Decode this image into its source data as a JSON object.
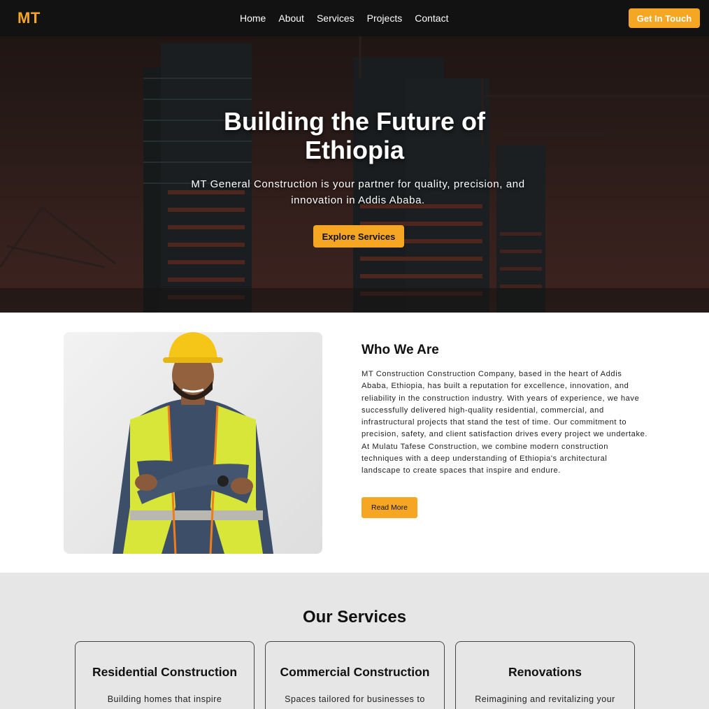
{
  "brand": {
    "logo": "MT",
    "accent_color": "#f5a623"
  },
  "nav": {
    "links": [
      "Home",
      "About",
      "Services",
      "Projects",
      "Contact"
    ],
    "cta_label": "Get In Touch"
  },
  "hero": {
    "title_line1": "Building the Future of",
    "title_line2": "Ethiopia",
    "subtitle": "MT General Construction is your partner for quality, precision, and innovation in Addis Ababa.",
    "button_label": "Explore Services"
  },
  "about": {
    "title": "Who We Are",
    "body": "MT Construction Construction Company, based in the heart of Addis Ababa, Ethiopia, has built a reputation for excellence, innovation, and reliability in the construction industry. With years of experience, we have successfully delivered high-quality residential, commercial, and infrastructural projects that stand the test of time. Our commitment to precision, safety, and client satisfaction drives every project we undertake. At Mulatu Tafese Construction, we combine modern construction techniques with a deep understanding of Ethiopia's architectural landscape to create spaces that inspire and endure.",
    "button_label": "Read More"
  },
  "services": {
    "title": "Our Services",
    "cards": [
      {
        "title": "Residential Construction",
        "desc": "Building homes that inspire"
      },
      {
        "title": "Commercial Construction",
        "desc": "Spaces tailored for businesses to"
      },
      {
        "title": "Renovations",
        "desc": "Reimagining and revitalizing your"
      }
    ]
  }
}
